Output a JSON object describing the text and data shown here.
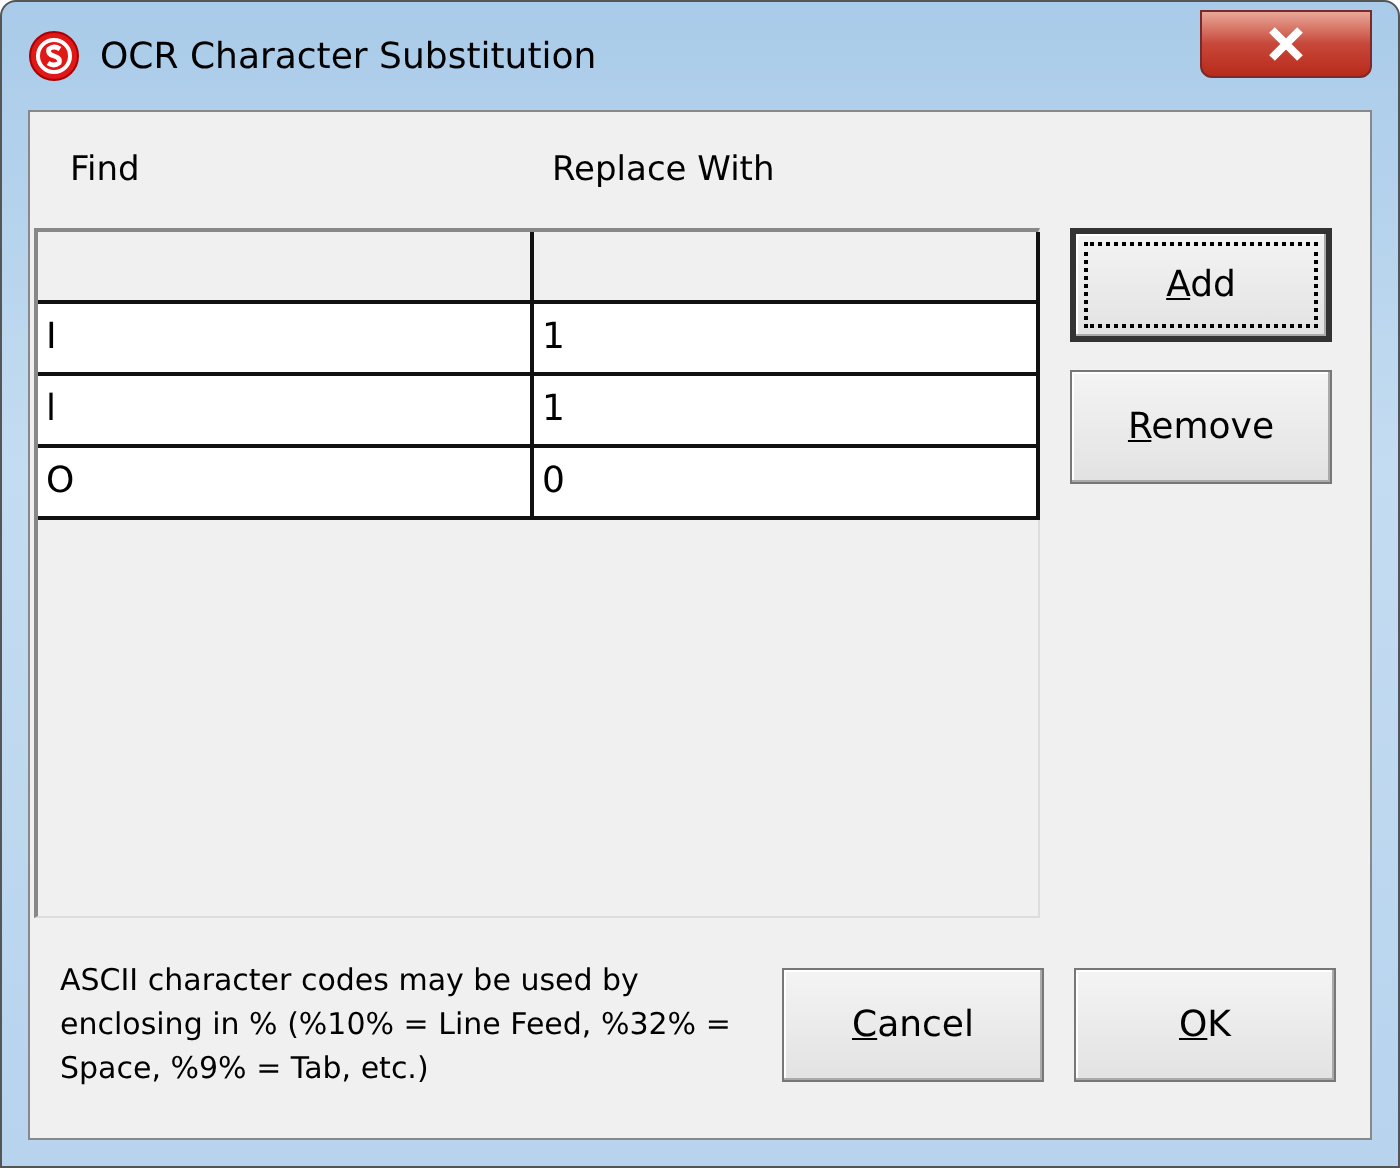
{
  "window": {
    "title": "OCR Character Substitution"
  },
  "columns": [
    "Find",
    "Replace With"
  ],
  "rows": [
    {
      "find": "I",
      "replace": "1"
    },
    {
      "find": "l",
      "replace": "1"
    },
    {
      "find": "O",
      "replace": "0"
    }
  ],
  "side_buttons": [
    {
      "label": "Add",
      "underline_first": true,
      "focused": true
    },
    {
      "label": "Remove",
      "underline_first": true,
      "focused": false
    }
  ],
  "note": "ASCII character codes may be used by enclosing in % (%10% = Line Feed, %32% = Space, %9% = Tab, etc.)",
  "bottom_buttons": [
    {
      "label": "Cancel",
      "underline_first": true,
      "focused": false
    },
    {
      "label": "OK",
      "underline_first": true,
      "focused": false
    }
  ]
}
